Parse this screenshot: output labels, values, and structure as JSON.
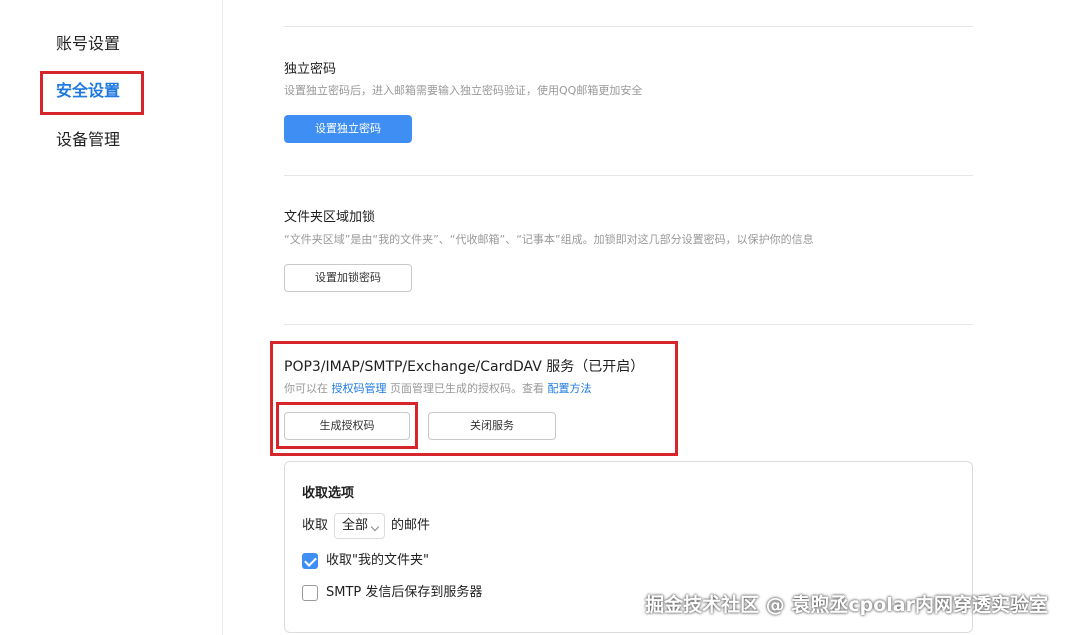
{
  "sidebar": {
    "items": [
      {
        "label": "账号设置"
      },
      {
        "label": "安全设置"
      },
      {
        "label": "设备管理"
      }
    ]
  },
  "sections": {
    "independent_password": {
      "title": "独立密码",
      "desc": "设置独立密码后，进入邮箱需要输入独立密码验证，使用QQ邮箱更加安全",
      "button": "设置独立密码"
    },
    "folder_lock": {
      "title": "文件夹区域加锁",
      "desc": "“文件夹区域”是由“我的文件夹”、“代收邮箱”、“记事本”组成。加锁即对这几部分设置密码，以保护你的信息",
      "button": "设置加锁密码"
    },
    "pop3_service": {
      "title": "POP3/IMAP/SMTP/Exchange/CardDAV 服务（已开启）",
      "desc_prefix": "你可以在",
      "desc_link1": "授权码管理",
      "desc_middle": "页面管理已生成的授权码。查看",
      "desc_link2": "配置方法",
      "generate_button": "生成授权码",
      "close_button": "关闭服务"
    }
  },
  "receive_options": {
    "title": "收取选项",
    "receive_prefix": "收取",
    "receive_select": "全部",
    "receive_suffix": "的邮件",
    "checkbox1_label": "收取\"我的文件夹\"",
    "checkbox1_checked": true,
    "checkbox2_label": "SMTP 发信后保存到服务器",
    "checkbox2_checked": false
  },
  "watermark": "掘金技术社区 @ 袁煦丞cpolar内网穿透实验室",
  "colors": {
    "accent": "#3f8ef3",
    "link": "#1f7ae0",
    "highlight_box": "#d6262b"
  }
}
